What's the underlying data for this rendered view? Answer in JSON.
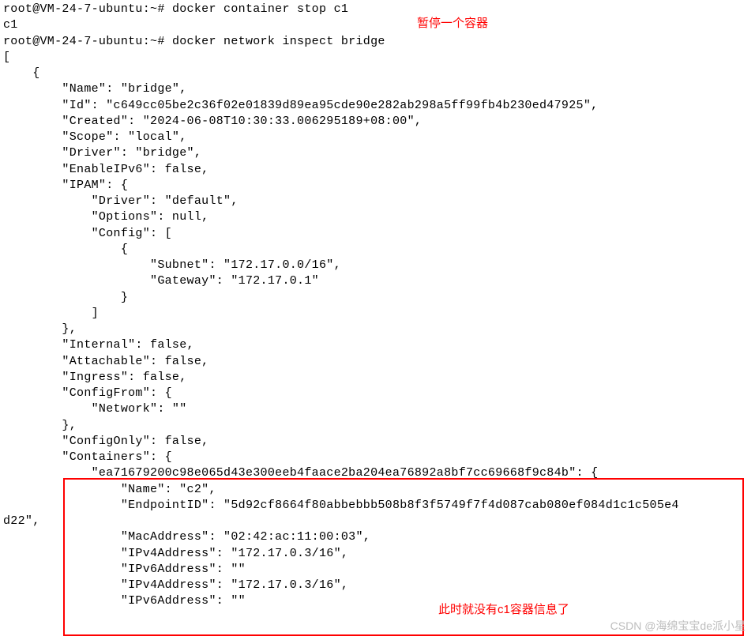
{
  "prompt1": "root@VM-24-7-ubuntu:~# ",
  "cmd1": "docker container stop c1",
  "out1": "c1",
  "prompt2": "root@VM-24-7-ubuntu:~# ",
  "cmd2": "docker network inspect bridge",
  "annotation1": "暂停一个容器",
  "annotation2": "此时就没有c1容器信息了",
  "watermark": "CSDN @海绵宝宝de派小星",
  "json": {
    "l0": "[",
    "l1": "    {",
    "l2": "        \"Name\": \"bridge\",",
    "l3": "        \"Id\": \"c649cc05be2c36f02e01839d89ea95cde90e282ab298a5ff99fb4b230ed47925\",",
    "l4": "        \"Created\": \"2024-06-08T10:30:33.006295189+08:00\",",
    "l5": "        \"Scope\": \"local\",",
    "l6": "        \"Driver\": \"bridge\",",
    "l7": "        \"EnableIPv6\": false,",
    "l8": "        \"IPAM\": {",
    "l9": "            \"Driver\": \"default\",",
    "l10": "            \"Options\": null,",
    "l11": "            \"Config\": [",
    "l12": "                {",
    "l13": "                    \"Subnet\": \"172.17.0.0/16\",",
    "l14": "                    \"Gateway\": \"172.17.0.1\"",
    "l15": "                }",
    "l16": "            ]",
    "l17": "        },",
    "l18": "        \"Internal\": false,",
    "l19": "        \"Attachable\": false,",
    "l20": "        \"Ingress\": false,",
    "l21": "        \"ConfigFrom\": {",
    "l22": "            \"Network\": \"\"",
    "l23": "        },",
    "l24": "        \"ConfigOnly\": false,",
    "l25": "        \"Containers\": {",
    "l26": "            \"ea71679200c98e065d43e300eeb4faace2ba204ea76892a8bf7cc69668f9c84b\": {",
    "l27": "                \"Name\": \"c2\",",
    "l28": "                \"EndpointID\": \"5d92cf8664f80abbebbb508b8f3f5749f7f4d087cab080ef084d1c1c505e4",
    "l28b": "d22\",",
    "l29": "                \"MacAddress\": \"02:42:ac:11:00:03\",",
    "l30": "                \"IPv4Address\": \"172.17.0.3/16\",",
    "l31": "                \"IPv6Address\": \"\"",
    "l32": "                \"IPv4Address\": \"172.17.0.3/16\",",
    "l33": "                \"IPv6Address\": \"\""
  }
}
